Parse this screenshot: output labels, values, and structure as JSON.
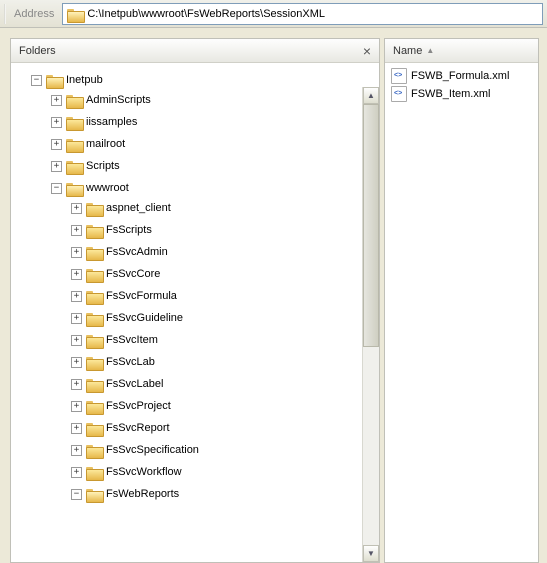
{
  "address": {
    "label": "Address",
    "path": "C:\\Inetpub\\wwwroot\\FsWebReports\\SessionXML"
  },
  "leftPane": {
    "title": "Folders",
    "close": "×"
  },
  "rightPane": {
    "columnHeader": "Name",
    "sortIndicator": "▲"
  },
  "tree": {
    "root": {
      "label": "Inetpub",
      "expanded": true,
      "children": [
        {
          "label": "AdminScripts",
          "expanded": false,
          "hasChildren": true
        },
        {
          "label": "iissamples",
          "expanded": false,
          "hasChildren": true
        },
        {
          "label": "mailroot",
          "expanded": false,
          "hasChildren": true
        },
        {
          "label": "Scripts",
          "expanded": false,
          "hasChildren": true
        },
        {
          "label": "wwwroot",
          "expanded": true,
          "hasChildren": true,
          "children": [
            {
              "label": "aspnet_client",
              "expanded": false,
              "hasChildren": true
            },
            {
              "label": "FsScripts",
              "expanded": false,
              "hasChildren": true
            },
            {
              "label": "FsSvcAdmin",
              "expanded": false,
              "hasChildren": true
            },
            {
              "label": "FsSvcCore",
              "expanded": false,
              "hasChildren": true
            },
            {
              "label": "FsSvcFormula",
              "expanded": false,
              "hasChildren": true
            },
            {
              "label": "FsSvcGuideline",
              "expanded": false,
              "hasChildren": true
            },
            {
              "label": "FsSvcItem",
              "expanded": false,
              "hasChildren": true
            },
            {
              "label": "FsSvcLab",
              "expanded": false,
              "hasChildren": true
            },
            {
              "label": "FsSvcLabel",
              "expanded": false,
              "hasChildren": true
            },
            {
              "label": "FsSvcProject",
              "expanded": false,
              "hasChildren": true
            },
            {
              "label": "FsSvcReport",
              "expanded": false,
              "hasChildren": true
            },
            {
              "label": "FsSvcSpecification",
              "expanded": false,
              "hasChildren": true
            },
            {
              "label": "FsSvcWorkflow",
              "expanded": false,
              "hasChildren": true
            },
            {
              "label": "FsWebReports",
              "expanded": true,
              "hasChildren": true
            }
          ]
        }
      ]
    }
  },
  "files": [
    {
      "name": "FSWB_Formula.xml"
    },
    {
      "name": "FSWB_Item.xml"
    }
  ]
}
